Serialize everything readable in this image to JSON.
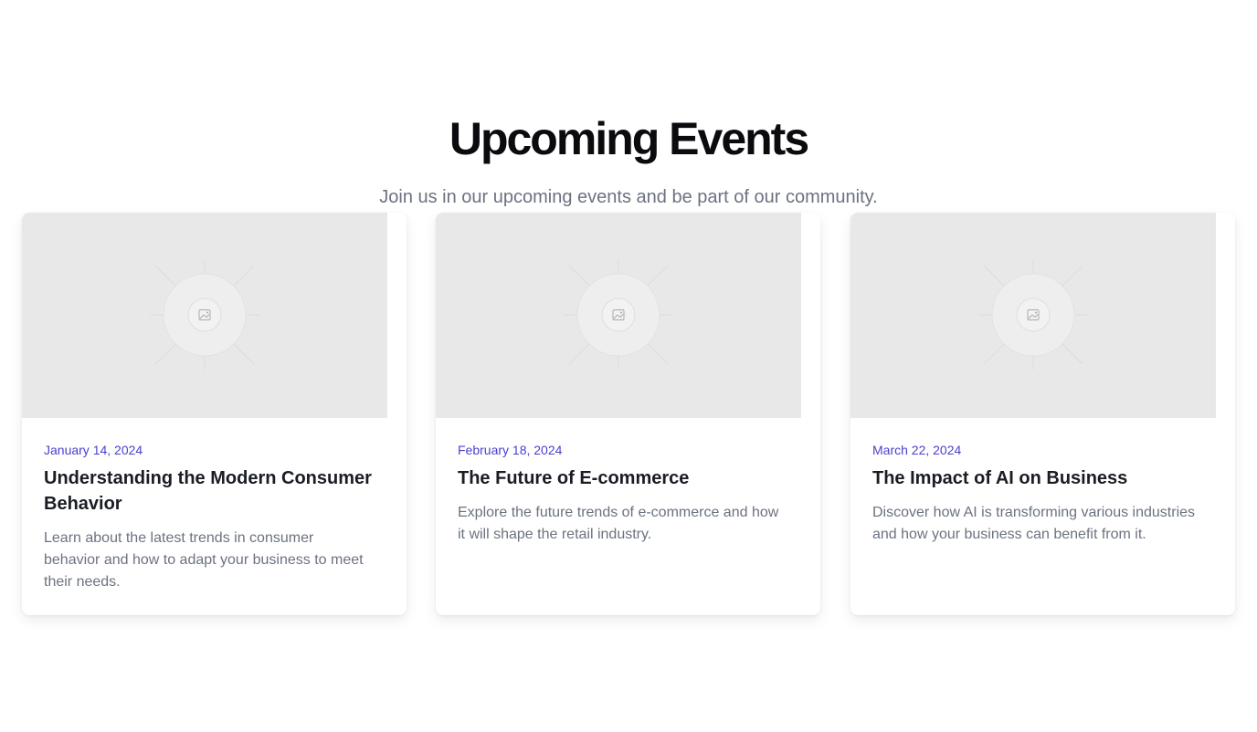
{
  "header": {
    "title": "Upcoming Events",
    "subtitle": "Join us in our upcoming events and be part of our community."
  },
  "colors": {
    "accent": "#4b3fcf",
    "heading": "#0b0b0f",
    "muted": "#6b7280",
    "placeholder": "#e8e8e8"
  },
  "events": [
    {
      "date": "January 14, 2024",
      "title": "Understanding the Modern Consumer Behavior",
      "description": "Learn about the latest trends in consumer behavior and how to adapt your business to meet their needs.",
      "image_icon": "image-placeholder-icon"
    },
    {
      "date": "February 18, 2024",
      "title": "The Future of E-commerce",
      "description": "Explore the future trends of e-commerce and how it will shape the retail industry.",
      "image_icon": "image-placeholder-icon"
    },
    {
      "date": "March 22, 2024",
      "title": "The Impact of AI on Business",
      "description": "Discover how AI is transforming various industries and how your business can benefit from it.",
      "image_icon": "image-placeholder-icon"
    }
  ]
}
